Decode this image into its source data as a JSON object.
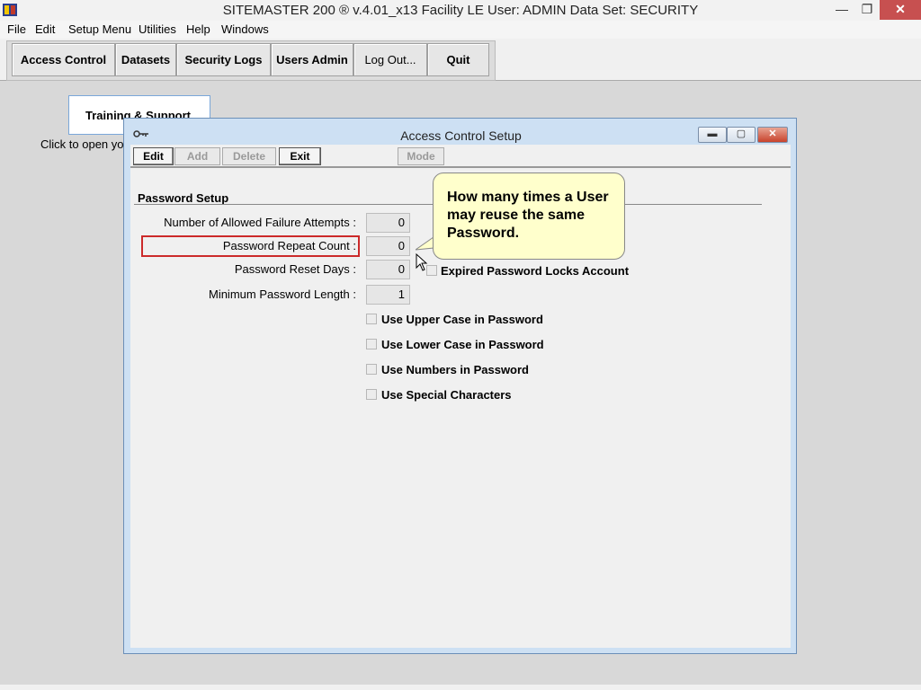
{
  "window": {
    "title": "SITEMASTER 200 ® v.4.01_x13 Facility LE    User: ADMIN    Data Set: SECURITY",
    "minimize": "—",
    "restore": "❐",
    "close": "✕"
  },
  "menubar": {
    "items": [
      "File",
      "Edit",
      "Setup Menu",
      "Utilities",
      "Help",
      "Windows"
    ]
  },
  "toolbar": {
    "access_control": "Access Control",
    "datasets": "Datasets",
    "security_logs": "Security Logs",
    "users_admin": "Users Admin",
    "log_out": "Log Out...",
    "quit": "Quit"
  },
  "training": {
    "label": "Training & Support",
    "click_text": "Click to open yo"
  },
  "dialog": {
    "title": "Access Control Setup",
    "buttons": {
      "edit": "Edit",
      "add": "Add",
      "delete": "Delete",
      "exit": "Exit",
      "mode": "Mode"
    },
    "section_title": "Password Setup",
    "fields": {
      "failure_attempts": {
        "label": "Number of Allowed Failure Attempts :",
        "value": "0"
      },
      "repeat_count": {
        "label": "Password Repeat Count :",
        "value": "0"
      },
      "reset_days": {
        "label": "Password Reset Days :",
        "value": "0"
      },
      "min_length": {
        "label": "Minimum Password Length :",
        "value": "1"
      }
    },
    "checkboxes": {
      "expired_locks": "Expired Password Locks Account",
      "upper_case": "Use Upper Case in Password",
      "lower_case": "Use Lower Case in Password",
      "numbers": "Use Numbers in Password",
      "special": "Use Special Characters"
    }
  },
  "callout": {
    "text": "How many times a User may reuse the same Password."
  },
  "colors": {
    "highlight": "#cc2a2a",
    "callout_bg": "#ffffcc",
    "dialog_frame": "#cde0f3"
  }
}
